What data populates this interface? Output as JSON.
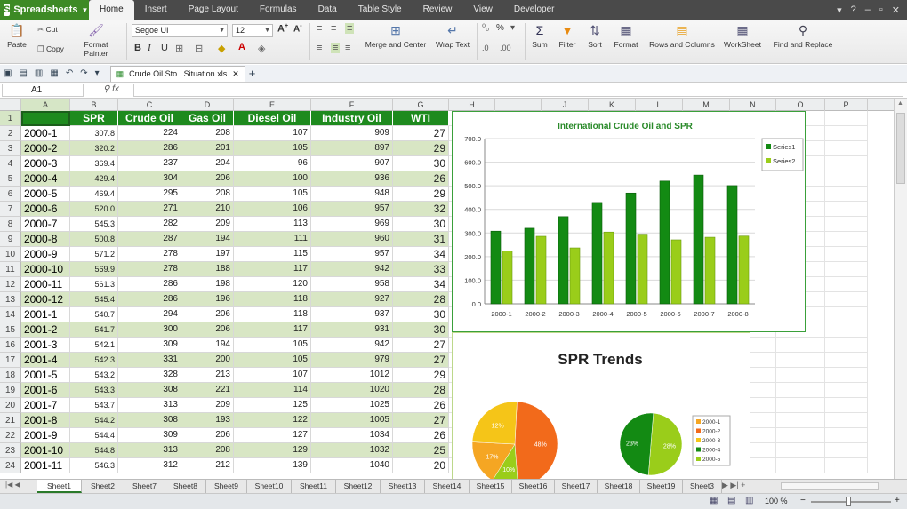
{
  "app": {
    "name": "Spreadsheets"
  },
  "menu": {
    "tabs": [
      "Home",
      "Insert",
      "Page Layout",
      "Formulas",
      "Data",
      "Table Style",
      "Review",
      "View",
      "Developer"
    ]
  },
  "ribbon": {
    "paste": "Paste",
    "cut": "Cut",
    "copy": "Copy",
    "format_painter": "Format Painter",
    "font_name": "Segoe UI",
    "font_size": "12",
    "merge_center": "Merge and Center",
    "wrap_text": "Wrap Text",
    "sum": "Sum",
    "filter": "Filter",
    "sort": "Sort",
    "format": "Format",
    "rows_columns": "Rows and Columns",
    "worksheet": "WorkSheet",
    "find_replace": "Find and Replace"
  },
  "document": {
    "tab_name": "Crude Oil Sto...Situation.xls"
  },
  "formula_bar": {
    "cell_ref": "A1",
    "fx": "fx"
  },
  "columns": [
    "A",
    "B",
    "C",
    "D",
    "E",
    "F",
    "G",
    "H",
    "I",
    "J",
    "K",
    "L",
    "M",
    "N",
    "O",
    "P"
  ],
  "rows": [
    "1",
    "2",
    "3",
    "4",
    "5",
    "6",
    "7",
    "8",
    "9",
    "10",
    "11",
    "12",
    "13",
    "14",
    "15",
    "16",
    "17",
    "18",
    "19",
    "20",
    "21",
    "22",
    "23",
    "24"
  ],
  "headers": [
    "",
    "SPR",
    "Crude Oil",
    "Gas Oil",
    "Diesel Oil",
    "Industry Oil",
    "WTI"
  ],
  "table": [
    [
      "2000-1",
      "307.8",
      "224",
      "208",
      "107",
      "909",
      "27"
    ],
    [
      "2000-2",
      "320.2",
      "286",
      "201",
      "105",
      "897",
      "29"
    ],
    [
      "2000-3",
      "369.4",
      "237",
      "204",
      "96",
      "907",
      "30"
    ],
    [
      "2000-4",
      "429.4",
      "304",
      "206",
      "100",
      "936",
      "26"
    ],
    [
      "2000-5",
      "469.4",
      "295",
      "208",
      "105",
      "948",
      "29"
    ],
    [
      "2000-6",
      "520.0",
      "271",
      "210",
      "106",
      "957",
      "32"
    ],
    [
      "2000-7",
      "545.3",
      "282",
      "209",
      "113",
      "969",
      "30"
    ],
    [
      "2000-8",
      "500.8",
      "287",
      "194",
      "111",
      "960",
      "31"
    ],
    [
      "2000-9",
      "571.2",
      "278",
      "197",
      "115",
      "957",
      "34"
    ],
    [
      "2000-10",
      "569.9",
      "278",
      "188",
      "117",
      "942",
      "33"
    ],
    [
      "2000-11",
      "561.3",
      "286",
      "198",
      "120",
      "958",
      "34"
    ],
    [
      "2000-12",
      "545.4",
      "286",
      "196",
      "118",
      "927",
      "28"
    ],
    [
      "2001-1",
      "540.7",
      "294",
      "206",
      "118",
      "937",
      "30"
    ],
    [
      "2001-2",
      "541.7",
      "300",
      "206",
      "117",
      "931",
      "30"
    ],
    [
      "2001-3",
      "542.1",
      "309",
      "194",
      "105",
      "942",
      "27"
    ],
    [
      "2001-4",
      "542.3",
      "331",
      "200",
      "105",
      "979",
      "27"
    ],
    [
      "2001-5",
      "543.2",
      "328",
      "213",
      "107",
      "1012",
      "29"
    ],
    [
      "2001-6",
      "543.3",
      "308",
      "221",
      "114",
      "1020",
      "28"
    ],
    [
      "2001-7",
      "543.7",
      "313",
      "209",
      "125",
      "1025",
      "26"
    ],
    [
      "2001-8",
      "544.2",
      "308",
      "193",
      "122",
      "1005",
      "27"
    ],
    [
      "2001-9",
      "544.4",
      "309",
      "206",
      "127",
      "1034",
      "26"
    ],
    [
      "2001-10",
      "544.8",
      "313",
      "208",
      "129",
      "1032",
      "25"
    ],
    [
      "2001-11",
      "546.3",
      "312",
      "212",
      "139",
      "1040",
      "20"
    ]
  ],
  "sheets": [
    "Sheet1",
    "Sheet2",
    "Sheet7",
    "Sheet8",
    "Sheet9",
    "Sheet10",
    "Sheet11",
    "Sheet12",
    "Sheet13",
    "Sheet14",
    "Sheet15",
    "Sheet16",
    "Sheet17",
    "Sheet18",
    "Sheet19",
    "Sheet3"
  ],
  "status": {
    "zoom": "100 %"
  },
  "colors": {
    "header_green": "#1e8a1e",
    "band_green": "#d8e6c4",
    "series1": "#138a13",
    "series2": "#9acd1a"
  },
  "chart_data": [
    {
      "type": "bar",
      "title": "International Crude Oil and SPR",
      "categories": [
        "2000-1",
        "2000-2",
        "2000-3",
        "2000-4",
        "2000-5",
        "2000-6",
        "2000-7",
        "2000-8"
      ],
      "series": [
        {
          "name": "Series1",
          "values": [
            307.8,
            320.2,
            369.4,
            429.4,
            469.4,
            520.0,
            545.3,
            500.8
          ]
        },
        {
          "name": "Series2",
          "values": [
            224,
            286,
            237,
            304,
            295,
            271,
            282,
            287
          ]
        }
      ],
      "ylim": [
        0,
        700
      ],
      "yticks": [
        "0.0",
        "100.0",
        "200.0",
        "300.0",
        "400.0",
        "500.0",
        "600.0",
        "700.0"
      ],
      "grid": true,
      "legend": "right"
    },
    {
      "type": "pie",
      "title": "SPR Trends",
      "pies": [
        {
          "slices": [
            {
              "label": "48%",
              "value": 48,
              "color": "#f26a1b"
            },
            {
              "label": "10%",
              "value": 10,
              "color": "#9acd1a"
            },
            {
              "label": "17%",
              "value": 17,
              "color": "#f5a623"
            },
            {
              "label": "12%",
              "value": 25,
              "color": "#f5c518"
            }
          ]
        },
        {
          "slices": [
            {
              "label": "28%",
              "value": 50,
              "color": "#9acd1a"
            },
            {
              "label": "23%",
              "value": 50,
              "color": "#138a13"
            }
          ]
        }
      ],
      "legend": [
        "2000-1",
        "2000-2",
        "2000-3",
        "2000-4",
        "2000-5"
      ],
      "legend_colors": [
        "#f5a623",
        "#f26a1b",
        "#f5c518",
        "#138a13",
        "#9acd1a"
      ]
    }
  ]
}
